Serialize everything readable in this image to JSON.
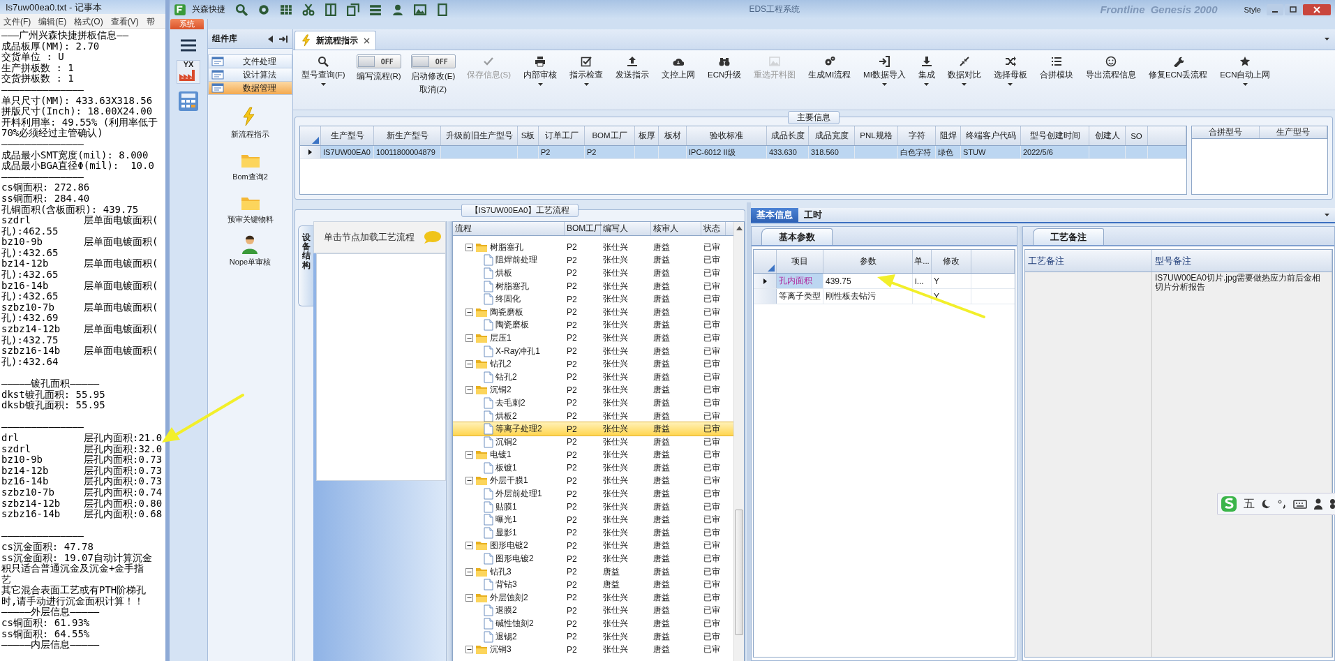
{
  "notepad": {
    "title": "Is7uw00ea0.txt - 记事本",
    "menu": [
      "文件(F)",
      "编辑(E)",
      "格式(O)",
      "查看(V)",
      "帮"
    ],
    "blocks": [
      [
        "———广州兴森快捷拼板信息——",
        "成品板厚(MM): 2.70",
        "交货单位 : U",
        "生产拼板数 : 1",
        "交货拼板数 : 1",
        "——————————————",
        "单只尺寸(MM): 433.63X318.56",
        "拼版尺寸(Inch): 18.00X24.00",
        "开料利用率: 49.55% (利用率低于",
        "70%必须经过主管确认)",
        "——————————————",
        "成品最小SMT宽度(mil): 8.000",
        "成品最小BGA直径Φ(mil):  10.0",
        "——————————————",
        "cs铜面积: 272.86",
        "ss铜面积: 284.40",
        "孔铜面积(含板面积): 439.75",
        "szdrl         层单面电镀面积(",
        "孔):462.55",
        "bz10-9b       层单面电镀面积(",
        "孔):432.65",
        "bz14-12b      层单面电镀面积(",
        "孔):432.65",
        "bz16-14b      层单面电镀面积(",
        "孔):432.65",
        "szbz10-7b     层单面电镀面积(",
        "孔):432.69",
        "szbz14-12b    层单面电镀面积(",
        "孔):432.75",
        "szbz16-14b    层单面电镀面积(",
        "孔):432.64"
      ],
      [
        "—————镀孔面积—————",
        "dkst镀孔面积: 55.95",
        "dksb镀孔面积: 55.95"
      ],
      [
        "——————————————",
        "drl           层孔内面积:21.0",
        "szdrl         层孔内面积:32.0",
        "bz10-9b       层孔内面积:0.73",
        "bz14-12b      层孔内面积:0.73",
        "bz16-14b      层孔内面积:0.73",
        "szbz10-7b     层孔内面积:0.74",
        "szbz14-12b    层孔内面积:0.80",
        "szbz16-14b    层孔内面积:0.68"
      ],
      [
        "——————————————",
        "cs沉金面积: 47.78",
        "ss沉金面积: 19.07自动计算沉金",
        "积只适合普通沉金及沉金+金手指",
        "艺",
        "其它混合表面工艺或有PTH阶梯孔",
        "时,请手动进行沉金面积计算！！",
        "—————外层信息—————",
        "cs铜面积: 61.93%",
        "ss铜面积: 64.55%",
        "—————内层信息—————"
      ]
    ]
  },
  "app": {
    "brand": "兴森快捷",
    "title": "EDS工程系统",
    "backdrop": [
      "Frontline",
      "Genesis 2000"
    ],
    "style_menu": "Style",
    "system_tab": "系统",
    "nav_badge": "YX"
  },
  "component_library": {
    "title": "组件库",
    "categories": [
      {
        "label": "文件处理",
        "selected": false
      },
      {
        "label": "设计算法",
        "selected": false
      },
      {
        "label": "数据管理",
        "selected": true
      }
    ],
    "modules": [
      {
        "label": "新流程指示"
      },
      {
        "label": "Bom查询2"
      },
      {
        "label": "预审关键物料"
      },
      {
        "label": "Nope单审核"
      }
    ]
  },
  "document_tabs": [
    {
      "label": "新流程指示",
      "selected": true
    }
  ],
  "toolbar": [
    {
      "kind": "button",
      "label": "型号查询(F)",
      "dropdown": true,
      "disabled": false
    },
    {
      "kind": "toggle",
      "label": "编写流程(R)",
      "on": false,
      "state_text": "OFF"
    },
    {
      "kind": "toggle",
      "label": "启动修改(E)",
      "secondary": "取消(Z)",
      "on": false,
      "state_text": "OFF"
    },
    {
      "kind": "button",
      "label": "保存信息(S)",
      "dropdown": false,
      "disabled": true
    },
    {
      "kind": "button",
      "label": "内部审核",
      "dropdown": true,
      "disabled": false
    },
    {
      "kind": "button",
      "label": "指示检查",
      "dropdown": true,
      "disabled": false
    },
    {
      "kind": "button",
      "label": "发送指示",
      "dropdown": false,
      "disabled": false
    },
    {
      "kind": "button",
      "label": "文控上网",
      "dropdown": false,
      "disabled": false
    },
    {
      "kind": "button",
      "label": "ECN升级",
      "dropdown": false,
      "disabled": false
    },
    {
      "kind": "button",
      "label": "重选开料图",
      "dropdown": false,
      "disabled": true
    },
    {
      "kind": "button",
      "label": "生成MI流程",
      "dropdown": false,
      "disabled": false
    },
    {
      "kind": "button",
      "label": "MI数据导入",
      "dropdown": true,
      "disabled": false
    },
    {
      "kind": "button",
      "label": "集成",
      "dropdown": true,
      "disabled": false
    },
    {
      "kind": "button",
      "label": "数据对比",
      "dropdown": true,
      "disabled": false
    },
    {
      "kind": "button",
      "label": "选择母板",
      "dropdown": true,
      "disabled": false
    },
    {
      "kind": "button",
      "label": "合拼模块",
      "dropdown": false,
      "disabled": false
    },
    {
      "kind": "button",
      "label": "导出流程信息",
      "dropdown": false,
      "disabled": false
    },
    {
      "kind": "button",
      "label": "修复ECN丢流程",
      "dropdown": false,
      "disabled": false
    },
    {
      "kind": "button",
      "label": "ECN自动上网",
      "dropdown": true,
      "disabled": false
    }
  ],
  "main_info": {
    "title": "主要信息",
    "columns": [
      "生产型号",
      "新生产型号",
      "升级前旧生产型号",
      "S板",
      "订单工厂",
      "BOM工厂",
      "板厚",
      "板材",
      "验收标准",
      "成品长度",
      "成品宽度",
      "PNL规格",
      "字符",
      "阻焊",
      "终端客户代码",
      "型号创建时间",
      "创建人",
      "SO"
    ],
    "rows": [
      {
        "selected": true,
        "cells": [
          "IS7UW00EA0",
          "10011800004879",
          null,
          null,
          "P2",
          "P2",
          null,
          null,
          "IPC-6012 II级",
          "433.630",
          "318.560",
          null,
          "白色字符",
          "绿色",
          "STUW",
          "2022/5/6",
          null,
          null
        ]
      }
    ],
    "side_columns": [
      "合拼型号",
      "生产型号"
    ]
  },
  "process_flow": {
    "title": "【IS7UW00EA0】工艺流程",
    "side_tab": "设备结构",
    "hint": "单击节点加载工艺流程",
    "columns": [
      "流程",
      "BOM工厂",
      "编写人",
      "核审人",
      "状态"
    ],
    "tree": [
      {
        "name": "树脂塞孔",
        "bom": "P2",
        "author": "张仕兴",
        "reviewer": "唐益",
        "status": "已审",
        "expanded": true,
        "selected": false,
        "children": [
          {
            "name": "阻焊前处理",
            "bom": "P2",
            "author": "张仕兴",
            "reviewer": "唐益",
            "status": "已审",
            "selected": false
          },
          {
            "name": "烘板",
            "bom": "P2",
            "author": "张仕兴",
            "reviewer": "唐益",
            "status": "已审",
            "selected": false
          },
          {
            "name": "树脂塞孔",
            "bom": "P2",
            "author": "张仕兴",
            "reviewer": "唐益",
            "status": "已审",
            "selected": false
          },
          {
            "name": "终固化",
            "bom": "P2",
            "author": "张仕兴",
            "reviewer": "唐益",
            "status": "已审",
            "selected": false
          }
        ]
      },
      {
        "name": "陶瓷磨板",
        "bom": "P2",
        "author": "张仕兴",
        "reviewer": "唐益",
        "status": "已审",
        "expanded": true,
        "selected": false,
        "children": [
          {
            "name": "陶瓷磨板",
            "bom": "P2",
            "author": "张仕兴",
            "reviewer": "唐益",
            "status": "已审",
            "selected": false
          }
        ]
      },
      {
        "name": "层压1",
        "bom": "P2",
        "author": "张仕兴",
        "reviewer": "唐益",
        "status": "已审",
        "expanded": true,
        "selected": false,
        "children": [
          {
            "name": "X-Ray冲孔1",
            "bom": "P2",
            "author": "张仕兴",
            "reviewer": "唐益",
            "status": "已审",
            "selected": false
          }
        ]
      },
      {
        "name": "钻孔2",
        "bom": "P2",
        "author": "张仕兴",
        "reviewer": "唐益",
        "status": "已审",
        "expanded": true,
        "selected": false,
        "children": [
          {
            "name": "钻孔2",
            "bom": "P2",
            "author": "张仕兴",
            "reviewer": "唐益",
            "status": "已审",
            "selected": false
          }
        ]
      },
      {
        "name": "沉铜2",
        "bom": "P2",
        "author": "张仕兴",
        "reviewer": "唐益",
        "status": "已审",
        "expanded": true,
        "selected": false,
        "children": [
          {
            "name": "去毛刺2",
            "bom": "P2",
            "author": "张仕兴",
            "reviewer": "唐益",
            "status": "已审",
            "selected": false
          },
          {
            "name": "烘板2",
            "bom": "P2",
            "author": "张仕兴",
            "reviewer": "唐益",
            "status": "已审",
            "selected": false
          },
          {
            "name": "等离子处理2",
            "bom": "P2",
            "author": "张仕兴",
            "reviewer": "唐益",
            "status": "已审",
            "selected": true
          },
          {
            "name": "沉铜2",
            "bom": "P2",
            "author": "张仕兴",
            "reviewer": "唐益",
            "status": "已审",
            "selected": false
          }
        ]
      },
      {
        "name": "电镀1",
        "bom": "P2",
        "author": "张仕兴",
        "reviewer": "唐益",
        "status": "已审",
        "expanded": true,
        "selected": false,
        "children": [
          {
            "name": "板镀1",
            "bom": "P2",
            "author": "张仕兴",
            "reviewer": "唐益",
            "status": "已审",
            "selected": false
          }
        ]
      },
      {
        "name": "外层干膜1",
        "bom": "P2",
        "author": "张仕兴",
        "reviewer": "唐益",
        "status": "已审",
        "expanded": true,
        "selected": false,
        "children": [
          {
            "name": "外层前处理1",
            "bom": "P2",
            "author": "张仕兴",
            "reviewer": "唐益",
            "status": "已审",
            "selected": false
          },
          {
            "name": "贴膜1",
            "bom": "P2",
            "author": "张仕兴",
            "reviewer": "唐益",
            "status": "已审",
            "selected": false
          },
          {
            "name": "曝光1",
            "bom": "P2",
            "author": "张仕兴",
            "reviewer": "唐益",
            "status": "已审",
            "selected": false
          },
          {
            "name": "显影1",
            "bom": "P2",
            "author": "张仕兴",
            "reviewer": "唐益",
            "status": "已审",
            "selected": false
          }
        ]
      },
      {
        "name": "图形电镀2",
        "bom": "P2",
        "author": "张仕兴",
        "reviewer": "唐益",
        "status": "已审",
        "expanded": true,
        "selected": false,
        "children": [
          {
            "name": "图形电镀2",
            "bom": "P2",
            "author": "张仕兴",
            "reviewer": "唐益",
            "status": "已审",
            "selected": false
          }
        ]
      },
      {
        "name": "钻孔3",
        "bom": "P2",
        "author": "唐益",
        "reviewer": "唐益",
        "status": "已审",
        "expanded": true,
        "selected": false,
        "children": [
          {
            "name": "背钻3",
            "bom": "P2",
            "author": "唐益",
            "reviewer": "唐益",
            "status": "已审",
            "selected": false
          }
        ]
      },
      {
        "name": "外层蚀刻2",
        "bom": "P2",
        "author": "张仕兴",
        "reviewer": "唐益",
        "status": "已审",
        "expanded": true,
        "selected": false,
        "children": [
          {
            "name": "退膜2",
            "bom": "P2",
            "author": "张仕兴",
            "reviewer": "唐益",
            "status": "已审",
            "selected": false
          },
          {
            "name": "碱性蚀刻2",
            "bom": "P2",
            "author": "张仕兴",
            "reviewer": "唐益",
            "status": "已审",
            "selected": false
          },
          {
            "name": "退锡2",
            "bom": "P2",
            "author": "张仕兴",
            "reviewer": "唐益",
            "status": "已审",
            "selected": false
          }
        ]
      },
      {
        "name": "沉铜3",
        "bom": "P2",
        "author": "张仕兴",
        "reviewer": "唐益",
        "status": "已审",
        "expanded": true,
        "selected": false
      }
    ]
  },
  "detail": {
    "tabs": [
      {
        "label": "基本信息",
        "selected": true
      },
      {
        "label": "工时",
        "selected": false
      }
    ],
    "params": {
      "tab": "基本参数",
      "columns": [
        "项目",
        "参数",
        "单...",
        "修改"
      ],
      "rows": [
        {
          "selected": true,
          "cells": [
            "孔内面积",
            "439.75",
            "i...",
            "Y"
          ]
        },
        {
          "selected": false,
          "cells": [
            "等离子类型",
            "刚性板去钻污",
            null,
            "Y"
          ]
        }
      ]
    },
    "remarks": {
      "tab": "工艺备注",
      "columns": [
        "工艺备注",
        "型号备注"
      ],
      "cells": [
        null,
        "IS7UW00EA0切片.jpg需要做热应力前后金相切片分析报告"
      ]
    }
  },
  "ime_bar": {
    "mode": "五"
  }
}
